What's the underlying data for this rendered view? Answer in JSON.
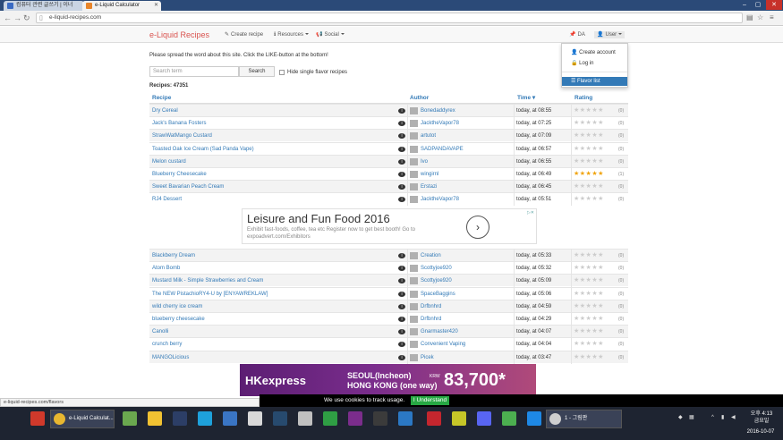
{
  "browser": {
    "tabs": [
      {
        "label": "컴퓨터 관련 글쓰기 | 이너",
        "active": false,
        "color": "#3a6bc4"
      },
      {
        "label": "e-Liquid Calculator",
        "active": true,
        "color": "#e8852a"
      }
    ],
    "url": "e-liquid-recipes.com",
    "status_url": "e-liquid-recipes.com/flavors"
  },
  "header": {
    "brand": "e-Liquid Recipes",
    "nav": {
      "create": "Create recipe",
      "resources": "Resources",
      "social": "Social",
      "da": "DA",
      "user": "User"
    }
  },
  "user_menu": {
    "items": [
      {
        "label": "Create account",
        "icon": "user-icon"
      },
      {
        "label": "Log in",
        "icon": "lock-icon"
      },
      {
        "label": "Flavor list",
        "icon": "list-icon",
        "selected": true
      }
    ]
  },
  "notice": "Please spread the word about this site. Click the LIKE-button at the bottom!",
  "search": {
    "placeholder": "Search term",
    "button": "Search",
    "hide_single_label": "Hide single flavor recipes"
  },
  "count_text": "Recipes: 47351",
  "table": {
    "headers": {
      "recipe": "Recipe",
      "author": "Author",
      "time": "Time",
      "rating": "Rating"
    },
    "rows_top": [
      {
        "recipe": "Dry Cereal",
        "author": "Bonedaddyrex",
        "time": "today, at 08:55",
        "stars": 0,
        "votes": "(0)"
      },
      {
        "recipe": "Jack's Banana Fosters",
        "author": "JacktheVapor78",
        "time": "today, at 07:25",
        "stars": 0,
        "votes": "(0)"
      },
      {
        "recipe": "StrawWatMango Custard",
        "author": "artutot",
        "time": "today, at 07:09",
        "stars": 0,
        "votes": "(0)"
      },
      {
        "recipe": "Toasted Oak Ice Cream (Sad Panda Vape)",
        "author": "SADPANDAVAPE",
        "time": "today, at 06:57",
        "stars": 0,
        "votes": "(0)"
      },
      {
        "recipe": "Melon custard",
        "author": "Ivo",
        "time": "today, at 06:55",
        "stars": 0,
        "votes": "(0)"
      },
      {
        "recipe": "Blueberry Cheesecake",
        "author": "wingirnl",
        "time": "today, at 06:49",
        "stars": 5,
        "votes": "(1)"
      },
      {
        "recipe": "Sweet Bavarian Peach Cream",
        "author": "Erstazi",
        "time": "today, at 06:45",
        "stars": 0,
        "votes": "(0)"
      },
      {
        "recipe": "RJ4 Dessert",
        "author": "JacktheVapor78",
        "time": "today, at 05:51",
        "stars": 0,
        "votes": "(0)"
      }
    ],
    "rows_bottom": [
      {
        "recipe": "Blackberry Dream",
        "author": "Creation",
        "time": "today, at 05:33",
        "stars": 0,
        "votes": "(0)"
      },
      {
        "recipe": "Atom Bomb",
        "author": "Scottyjoe920",
        "time": "today, at 05:32",
        "stars": 0,
        "votes": "(0)"
      },
      {
        "recipe": "Mustard Milk - Simple Strawberries and Cream",
        "author": "Scottyjoe920",
        "time": "today, at 05:09",
        "stars": 0,
        "votes": "(0)"
      },
      {
        "recipe": "The NEW PistachioRY4-U by [ENYAWREKLAW]",
        "author": "SpaceBaggins",
        "time": "today, at 05:06",
        "stars": 0,
        "votes": "(0)"
      },
      {
        "recipe": "wild cherry ice cream",
        "author": "Drfbnhrd",
        "time": "today, at 04:59",
        "stars": 0,
        "votes": "(0)"
      },
      {
        "recipe": "blueberry cheesecake",
        "author": "Drfbnhrd",
        "time": "today, at 04:29",
        "stars": 0,
        "votes": "(0)"
      },
      {
        "recipe": "Canolli",
        "author": "Gnarmaster420",
        "time": "today, at 04:07",
        "stars": 0,
        "votes": "(0)"
      },
      {
        "recipe": "crunch berry",
        "author": "Convenient Vaping",
        "time": "today, at 04:04",
        "stars": 0,
        "votes": "(0)"
      },
      {
        "recipe": "MANGOLicious",
        "author": "Picek",
        "time": "today, at 03:47",
        "stars": 0,
        "votes": "(0)"
      }
    ]
  },
  "ad1": {
    "title": "Leisure and Fun Food 2016",
    "desc": "Exhibit fast-foods, coffee, tea etc Register now to get best booth! Go to",
    "url": "expoadvert.com/Exhibitors"
  },
  "ad2": {
    "brand": "HKexpress",
    "route1": "SEOUL(Incheon)",
    "route2": "HONG KONG (one way)",
    "currency": "KRW",
    "price": "83,700*"
  },
  "cookie": {
    "text": "We use cookies to track usage.",
    "button": "I Understand"
  },
  "taskbar": {
    "task1": "e-Liquid Calculat...",
    "task2": "1 - 그림판",
    "time": "오후 4:13",
    "day": "금요일",
    "date": "2016-10-07"
  },
  "colors": {
    "link": "#337ab7",
    "brand": "#d9534f",
    "star_on": "#f0a30a",
    "cookie_btn": "#27a844"
  }
}
